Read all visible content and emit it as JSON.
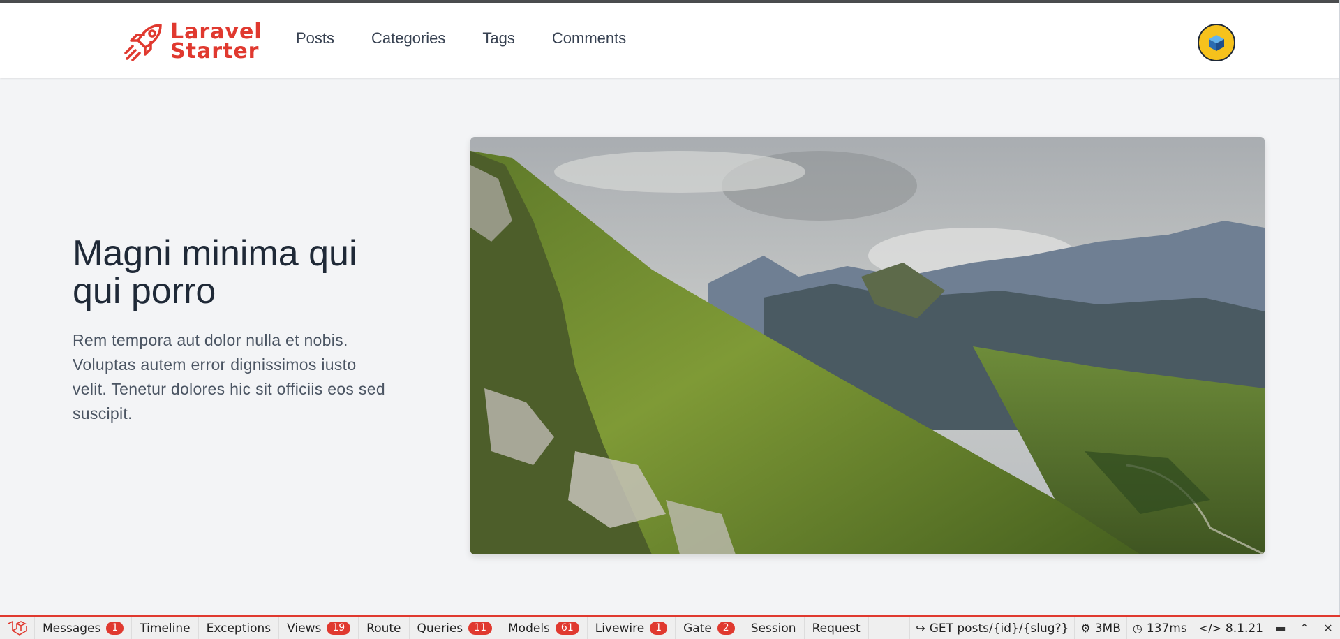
{
  "brand": {
    "line1": "Laravel",
    "line2": "Starter",
    "color": "#e0392f"
  },
  "nav": {
    "items": [
      {
        "label": "Posts"
      },
      {
        "label": "Categories"
      },
      {
        "label": "Tags"
      },
      {
        "label": "Comments"
      }
    ]
  },
  "user": {
    "avatar_icon": "cube-avatar-icon",
    "avatar_color": "#f6c21c"
  },
  "hero": {
    "title": "Magni minima qui qui porro",
    "body": "Rem tempora aut dolor nulla et nobis. Voluptas autem error dignissimos iusto velit. Tenetur dolores hic sit officiis eos sed suscipit.",
    "image_subject": "mountain-landscape-image"
  },
  "debugbar": {
    "tabs": [
      {
        "label": "Messages",
        "badge": "1"
      },
      {
        "label": "Timeline",
        "badge": null
      },
      {
        "label": "Exceptions",
        "badge": null
      },
      {
        "label": "Views",
        "badge": "19"
      },
      {
        "label": "Route",
        "badge": null
      },
      {
        "label": "Queries",
        "badge": "11"
      },
      {
        "label": "Models",
        "badge": "61"
      },
      {
        "label": "Livewire",
        "badge": "1"
      },
      {
        "label": "Gate",
        "badge": "2"
      },
      {
        "label": "Session",
        "badge": null
      },
      {
        "label": "Request",
        "badge": null
      }
    ],
    "route": "GET posts/{id}/{slug?}",
    "memory": "3MB",
    "time": "137ms",
    "php_version": "8.1.21"
  }
}
